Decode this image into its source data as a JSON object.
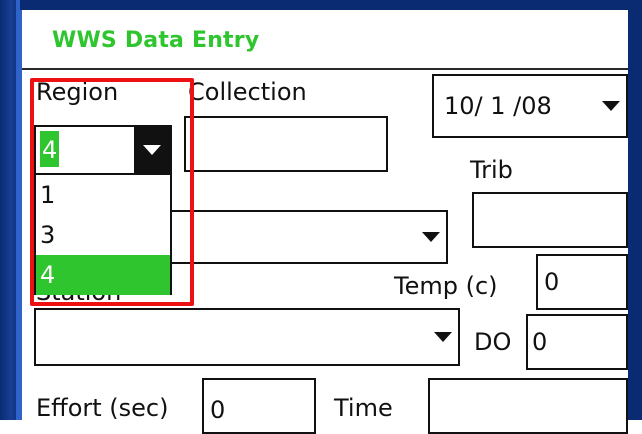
{
  "app": {
    "title": "WWS Data Entry"
  },
  "region": {
    "label": "Region",
    "value": "4",
    "options": [
      "1",
      "3",
      "4"
    ],
    "selected": "4"
  },
  "collection": {
    "label": "Collection",
    "value": ""
  },
  "date": {
    "value": "10/ 1 /08"
  },
  "trib": {
    "label": "Trib",
    "value": ""
  },
  "unlabeled_combo": {
    "value": ""
  },
  "station": {
    "label": "Station",
    "value": ""
  },
  "temp": {
    "label": "Temp (c)",
    "value": "0"
  },
  "do": {
    "label": "DO",
    "value": "0"
  },
  "effort": {
    "label": "Effort (sec)",
    "value": "0"
  },
  "time": {
    "label": "Time",
    "value": ""
  },
  "colors": {
    "accent": "#2ec52e",
    "frame": "#0a2b72",
    "highlight": "#ee1111"
  }
}
